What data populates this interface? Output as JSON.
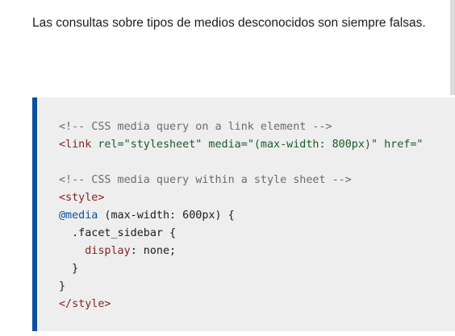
{
  "intro_text": "Las consultas sobre tipos de medios desconocidos son siempre falsas.",
  "code": {
    "comment_link": "<!-- CSS media query on a link element -->",
    "link_open": "<link",
    "link_rel_attr": " rel=",
    "link_rel_value": "\"stylesheet\"",
    "link_media_attr": " media=",
    "link_media_value": "\"(max-width: 800px)\"",
    "link_href_attr": " href=\"",
    "comment_style": "<!-- CSS media query within a style sheet -->",
    "style_open": "<style>",
    "at_media": "@media",
    "media_condition": " (max-width: 600px) {",
    "selector": "  .facet_sidebar {",
    "property": "    display",
    "property_value": ": none;",
    "close_inner": "  }",
    "close_outer": "}",
    "style_close": "</style>"
  },
  "colors": {
    "accent_border": "#0b4ea2",
    "code_background": "#eeeeee"
  }
}
